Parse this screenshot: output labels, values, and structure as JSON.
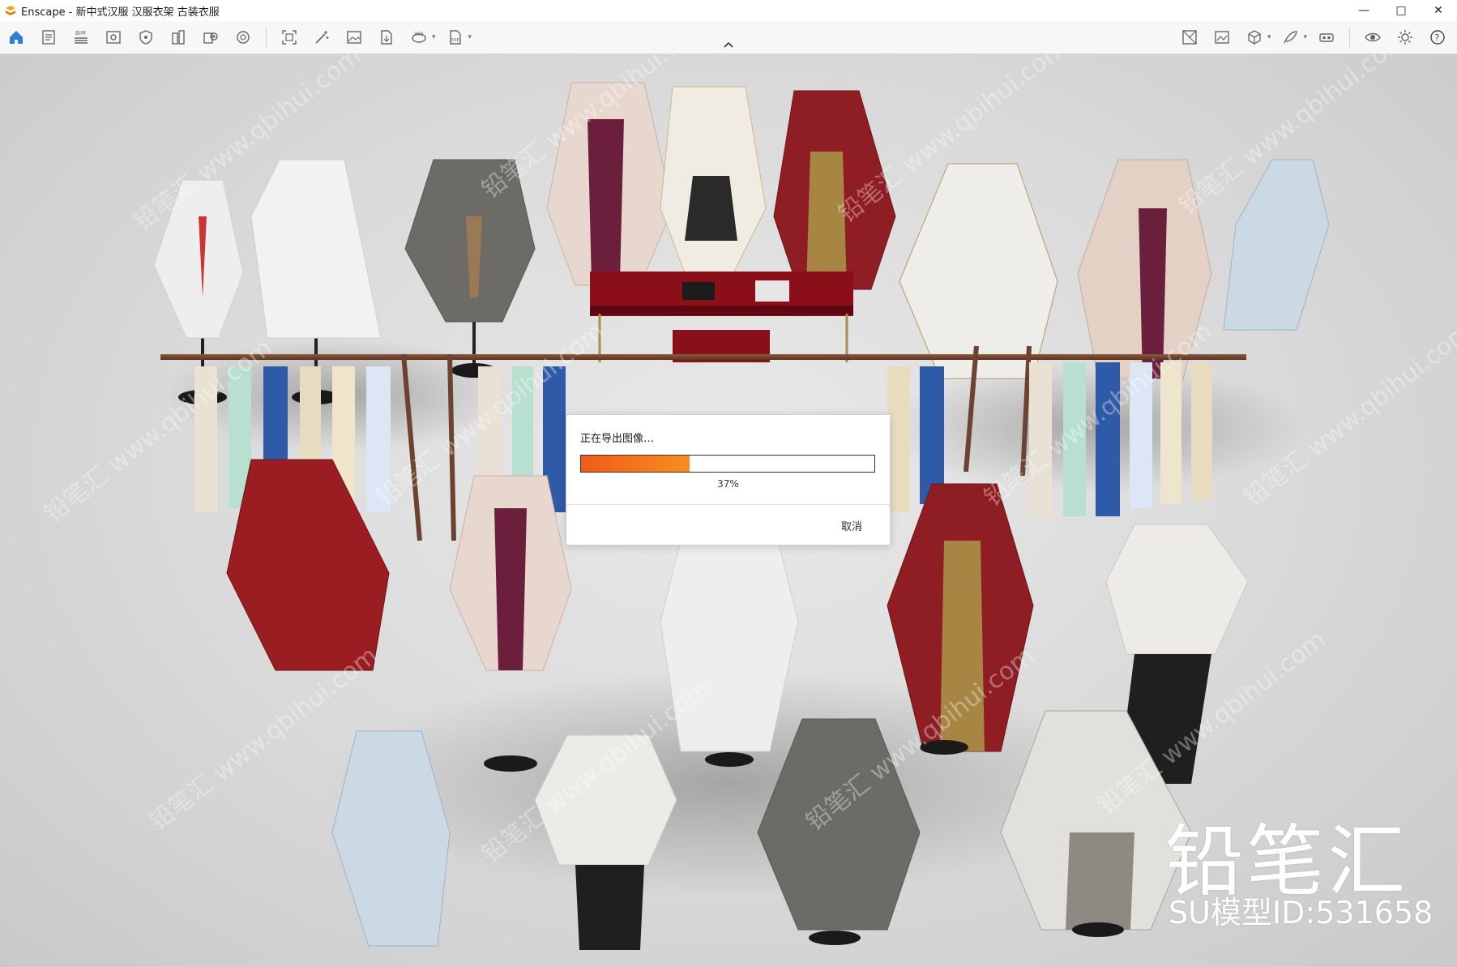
{
  "window": {
    "title": "Enscape - 新中式汉服 汉服衣架 古装衣服",
    "controls": [
      "minimize-icon",
      "maximize-icon",
      "close-icon"
    ]
  },
  "toolbar": {
    "left_icons": [
      "home-icon",
      "document-icon",
      "bim-icon",
      "view-icon",
      "shield-icon",
      "building-icon",
      "asset-library-icon",
      "atmosphere-icon",
      "screenshot-icon",
      "magic-wand-icon",
      "image-icon",
      "export-file-icon",
      "panorama-360-icon",
      "export-exe-icon"
    ],
    "right_icons": [
      "map-icon",
      "gallery-icon",
      "cube-icon",
      "feather-icon",
      "vr-headset-icon",
      "eye-icon",
      "settings-icon",
      "help-icon"
    ],
    "bim_label": "BIM",
    "view_360_label": "360",
    "exe_label": "EXE"
  },
  "dialog": {
    "title": "正在导出图像…",
    "progress_percent": 37,
    "progress_text": "37%",
    "cancel_label": "取消"
  },
  "watermark": {
    "brand": "铅笔汇",
    "model_id": "SU模型ID:531658",
    "tile_text": "铅笔汇 www.qbihui.com"
  },
  "colors": {
    "progress_fill": "#f26a1b",
    "toolbar_accent": "#2b7fd4"
  }
}
